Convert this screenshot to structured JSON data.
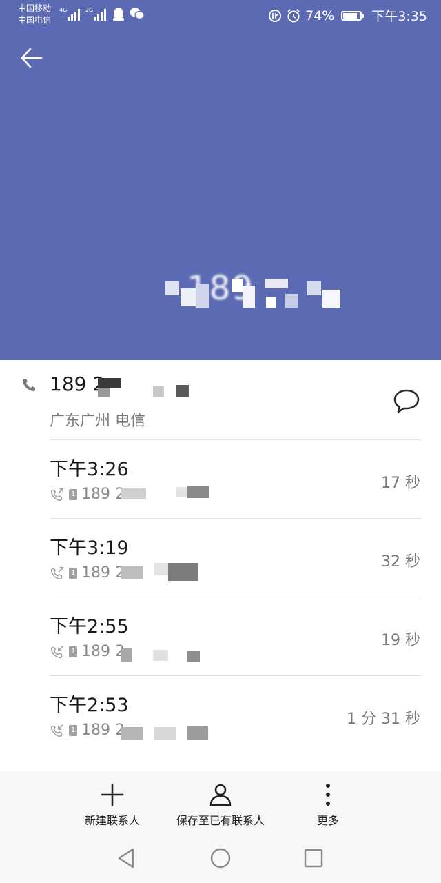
{
  "status_bar": {
    "carrier_1": "中国移动",
    "carrier_2": "中国电信",
    "network_1": "4G",
    "network_2": "2G",
    "battery": "74%",
    "time": "下午3:35"
  },
  "header": {
    "background": "#5c6ab3",
    "back_icon": "arrow-left-icon",
    "number": "189"
  },
  "contact": {
    "number": "189 2",
    "location": "广东广州 电信",
    "message_icon": "message-bubble-icon"
  },
  "call_log": [
    {
      "time": "下午3:26",
      "type": "outgoing",
      "number": "189 2",
      "duration": "17 秒"
    },
    {
      "time": "下午3:19",
      "type": "outgoing",
      "number": "189 2",
      "duration": "32 秒"
    },
    {
      "time": "下午2:55",
      "type": "incoming",
      "number": "189 2",
      "duration": "19 秒"
    },
    {
      "time": "下午2:53",
      "type": "incoming",
      "number": "189 2",
      "duration": "1 分 31 秒"
    }
  ],
  "actions": {
    "new_contact": "新建联系人",
    "save_existing": "保存至已有联系人",
    "more": "更多"
  },
  "colors": {
    "accent": "#5c6ab3",
    "text_primary": "#1a1a1a",
    "text_secondary": "#7a7a7a"
  }
}
